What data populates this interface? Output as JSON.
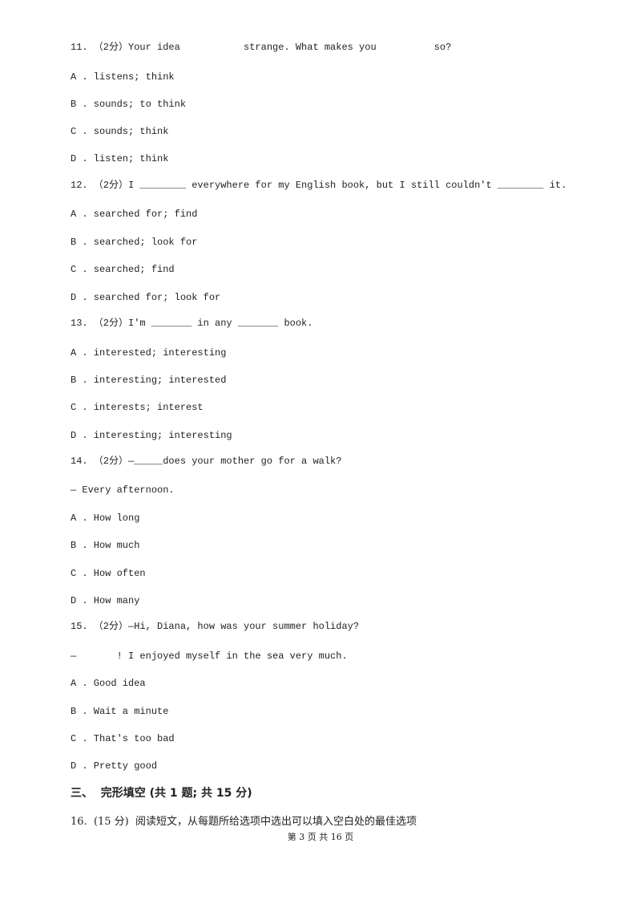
{
  "questions": [
    {
      "stem": "11. （2分）Your idea           strange. What makes you          so?",
      "options": [
        "A . listens; think",
        "B . sounds; to think",
        "C . sounds; think",
        "D . listen; think"
      ]
    },
    {
      "stem": "12. （2分）I ________ everywhere for my English book, but I still couldn't ________ it.",
      "options": [
        "A . searched for; find",
        "B . searched; look for",
        "C . searched; find",
        "D . searched for; look for"
      ]
    },
    {
      "stem": "13. （2分）I'm _______ in any _______ book.",
      "options": [
        "A . interested; interesting",
        "B . interesting; interested",
        "C . interests; interest",
        "D . interesting; interesting"
      ]
    },
    {
      "stem": "14. （2分）—_____does your mother go for a walk?",
      "extra": "— Every afternoon.",
      "options": [
        "A . How long",
        "B . How much",
        "C . How often",
        "D . How many"
      ]
    },
    {
      "stem": "15. （2分）—Hi, Diana, how was your summer holiday?",
      "extra": "—       ! I enjoyed myself in the sea very much.",
      "options": [
        "A . Good idea",
        "B . Wait a minute",
        "C . That's too bad",
        "D . Pretty good"
      ]
    }
  ],
  "section": "三、  完形填空 (共 1 题; 共 15 分)",
  "q16": "16.  (15 分)  阅读短文，从每题所给选项中选出可以填入空白处的最佳选项",
  "footer": "第 3 页 共 16 页"
}
